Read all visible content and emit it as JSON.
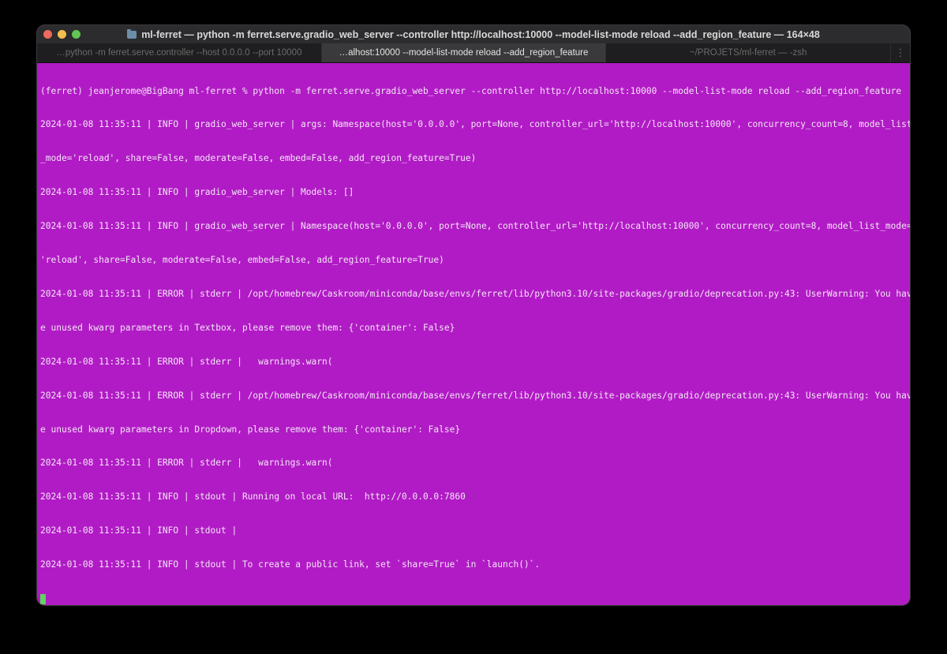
{
  "window": {
    "title": "ml-ferret — python -m ferret.serve.gradio_web_server --controller http://localhost:10000 --model-list-mode reload --add_region_feature — 164×48",
    "background": "#b11bc5"
  },
  "tabs": [
    {
      "label": "…python -m ferret.serve.controller --host 0.0.0.0 --port 10000",
      "active": false
    },
    {
      "label": "…alhost:10000 --model-list-mode reload --add_region_feature",
      "active": true
    },
    {
      "label": "~/PROJETS/ml-ferret — -zsh",
      "active": false
    }
  ],
  "terminal": {
    "lines": [
      "(ferret) jeanjerome@BigBang ml-ferret % python -m ferret.serve.gradio_web_server --controller http://localhost:10000 --model-list-mode reload --add_region_feature",
      "2024-01-08 11:35:11 | INFO | gradio_web_server | args: Namespace(host='0.0.0.0', port=None, controller_url='http://localhost:10000', concurrency_count=8, model_list",
      "_mode='reload', share=False, moderate=False, embed=False, add_region_feature=True)",
      "2024-01-08 11:35:11 | INFO | gradio_web_server | Models: []",
      "2024-01-08 11:35:11 | INFO | gradio_web_server | Namespace(host='0.0.0.0', port=None, controller_url='http://localhost:10000', concurrency_count=8, model_list_mode=",
      "'reload', share=False, moderate=False, embed=False, add_region_feature=True)",
      "2024-01-08 11:35:11 | ERROR | stderr | /opt/homebrew/Caskroom/miniconda/base/envs/ferret/lib/python3.10/site-packages/gradio/deprecation.py:43: UserWarning: You hav",
      "e unused kwarg parameters in Textbox, please remove them: {'container': False}",
      "2024-01-08 11:35:11 | ERROR | stderr |   warnings.warn(",
      "2024-01-08 11:35:11 | ERROR | stderr | /opt/homebrew/Caskroom/miniconda/base/envs/ferret/lib/python3.10/site-packages/gradio/deprecation.py:43: UserWarning: You hav",
      "e unused kwarg parameters in Dropdown, please remove them: {'container': False}",
      "2024-01-08 11:35:11 | ERROR | stderr |   warnings.warn(",
      "2024-01-08 11:35:11 | INFO | stdout | Running on local URL:  http://0.0.0.0:7860",
      "2024-01-08 11:35:11 | INFO | stdout |",
      "2024-01-08 11:35:11 | INFO | stdout | To create a public link, set `share=True` in `launch()`."
    ]
  }
}
